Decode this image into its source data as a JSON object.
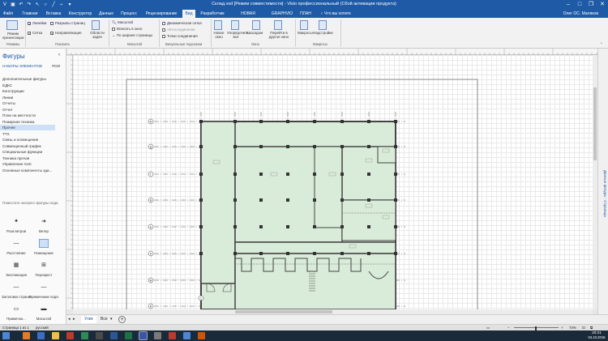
{
  "window": {
    "title": "Склад.vsd [Режим совместимости] - Visio профессиональный (Сбой активации продукта)",
    "user": "Олег ОС. Маляков"
  },
  "tabs": [
    "Файл",
    "Главная",
    "Вставка",
    "Конструктор",
    "Данные",
    "Процесс",
    "Рецензирование",
    "Вид",
    "Разработчик",
    "НОВАЯ ВКЛАДКА",
    "GRAPHVIO",
    "ПЛАН"
  ],
  "tell_me": "Что вы хотите сделать?",
  "ribbon": {
    "views": {
      "presentation": "Режим презентации",
      "group": "Режимы"
    },
    "show": {
      "ruler": "Линейки",
      "page_breaks": "Разрывы страниц",
      "grid": "Сетка",
      "guides": "Направляющие",
      "task_panes": "Области задач",
      "group": "Показать"
    },
    "zoom": {
      "zoom": "Масштаб",
      "fit": "Вписать в окно",
      "page_width": "По ширине страницы",
      "group": "Масштаб"
    },
    "visual_aids": {
      "dynamic_grid": "Динамическая сетка",
      "autoconnect": "Автосоединение",
      "connection_points": "Точки соединения",
      "group": "Визуальные подсказки"
    },
    "window": {
      "new_window": "Новое окно",
      "arrange_all": "Упорядочить все",
      "cascade": "Каскадом",
      "switch": "Перейти в другое окно",
      "group": "Окно"
    },
    "macros": {
      "macros": "Макросы",
      "addins": "Надстройки",
      "group": "Макросы"
    }
  },
  "shapes_pane": {
    "title": "Фигуры",
    "stencils_tab": "НАБОРЫ ЭЛЕМЕНТОВ",
    "search_tab": "ПОИ",
    "stencils": [
      "Дополнительные фигуры",
      "ЕДКС",
      "Конструкции",
      "Линии",
      "Отчеты",
      "Отчет",
      "План на местности",
      "Пожарная техника",
      "Прочее",
      "ТТХ",
      "Связь и оповещение",
      "Совмещенный график",
      "Специальные функции",
      "Техника прочая",
      "Управление СиС",
      "Основные компоненты зда..."
    ],
    "selected_stencil": "Прочее",
    "drop_hint": "Поместите экспресс-фигуры сюда",
    "shapes": [
      {
        "label": "Роза ветров",
        "icon": "compass-rose-icon"
      },
      {
        "label": "Ветер",
        "icon": "wind-arrow-icon"
      },
      {
        "label": "Расстояние",
        "icon": "distance-line-icon"
      },
      {
        "label": "Помещение",
        "icon": "room-icon",
        "selected": true
      },
      {
        "label": "Экспликация",
        "icon": "explication-table-icon"
      },
      {
        "label": "Перекрест",
        "icon": "crossing-icon"
      },
      {
        "label": "Заголовок страницы",
        "icon": "page-title-icon"
      },
      {
        "label": "Примечание подписи (д...",
        "icon": "note-icon"
      },
      {
        "label": "Примечан...",
        "icon": "note-small-icon"
      },
      {
        "label": "Масштаб",
        "icon": "scale-icon"
      }
    ]
  },
  "right_pane": {
    "label": "Данные фигуры - Страница"
  },
  "page_tabs": {
    "page": "Улик",
    "all": "Все",
    "add": "+"
  },
  "status": {
    "page": "Страница 1 из 1",
    "language": "русский",
    "zoom": "74%"
  },
  "taskbar": {
    "time": "20:21",
    "date": "04.10.2016"
  },
  "plan": {
    "axis_rows": [
      "Ф",
      "Д",
      "Г",
      "В",
      "Б",
      "А",
      "Ж",
      "И"
    ],
    "axis_col": "1"
  },
  "colors": {
    "accent": "#1e5aa6",
    "room_fill": "#d9ecd9"
  }
}
